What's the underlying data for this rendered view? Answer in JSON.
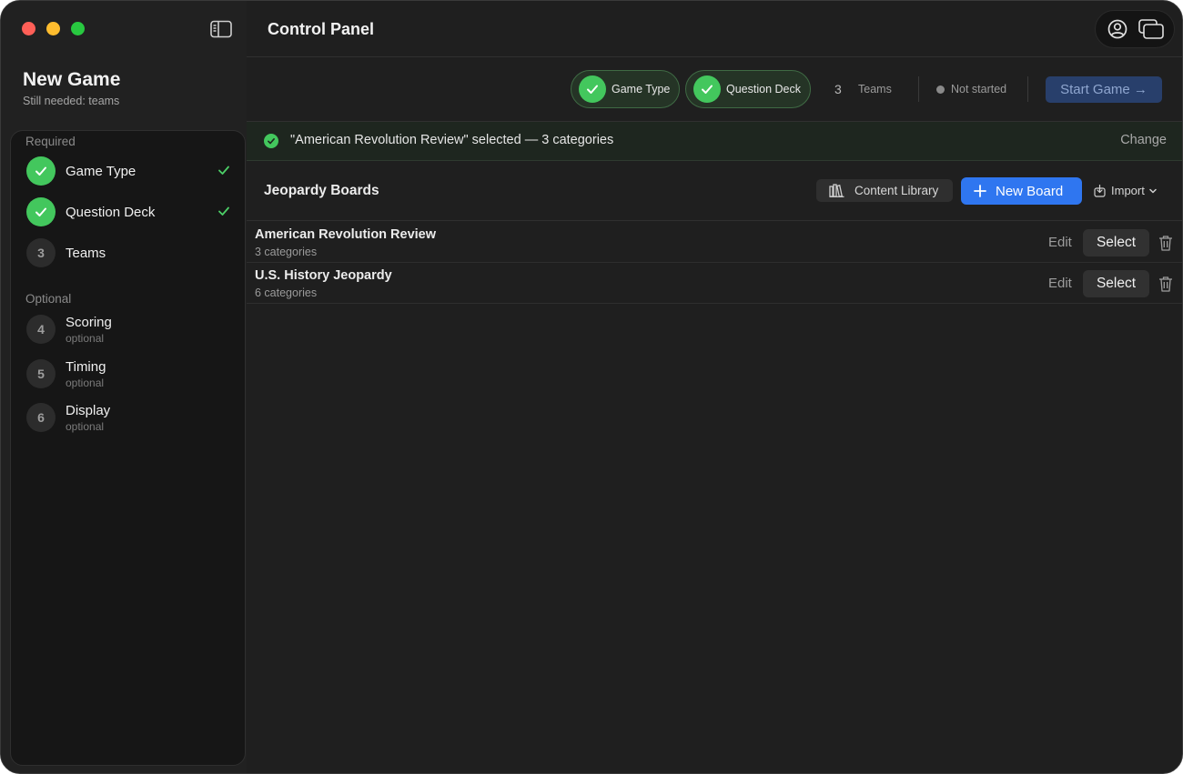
{
  "window": {
    "controls": [
      "close",
      "minimize",
      "zoom"
    ]
  },
  "header": {
    "title": "Control Panel",
    "icons": [
      "sidebar-toggle-icon",
      "account-icon",
      "windows-icon"
    ]
  },
  "game": {
    "title": "New Game",
    "subtitle": "Still needed: teams"
  },
  "sidebar": {
    "required_label": "Required",
    "optional_label": "Optional",
    "required_items": [
      {
        "label": "Game Type",
        "status": "done"
      },
      {
        "label": "Question Deck",
        "status": "done"
      },
      {
        "number": "3",
        "label": "Teams",
        "status": "pending"
      }
    ],
    "optional_items": [
      {
        "number": "4",
        "label": "Scoring",
        "sub": "optional"
      },
      {
        "number": "5",
        "label": "Timing",
        "sub": "optional"
      },
      {
        "number": "6",
        "label": "Display",
        "sub": "optional"
      }
    ]
  },
  "toolbar": {
    "steps": [
      {
        "label": "Game Type",
        "done": true
      },
      {
        "label": "Question Deck",
        "done": true
      }
    ],
    "teams_count": "3",
    "teams_label": "Teams",
    "status": "Not started",
    "start_label": "Start Game →"
  },
  "banner": {
    "text": "\"American Revolution Review\" selected — 3 categories",
    "action": "Change"
  },
  "boards": {
    "title": "Jeopardy Boards",
    "content_library_label": "Content Library",
    "new_board_label": "New Board",
    "import_label": "Import",
    "edit_label": "Edit",
    "select_label": "Select",
    "items": [
      {
        "name": "American Revolution Review",
        "meta": "3 categories"
      },
      {
        "name": "U.S. History Jeopardy",
        "meta": "6 categories"
      }
    ]
  },
  "colors": {
    "accent_green": "#43c75d",
    "accent_blue": "#2f76f0",
    "start_button": "#283f6b"
  }
}
